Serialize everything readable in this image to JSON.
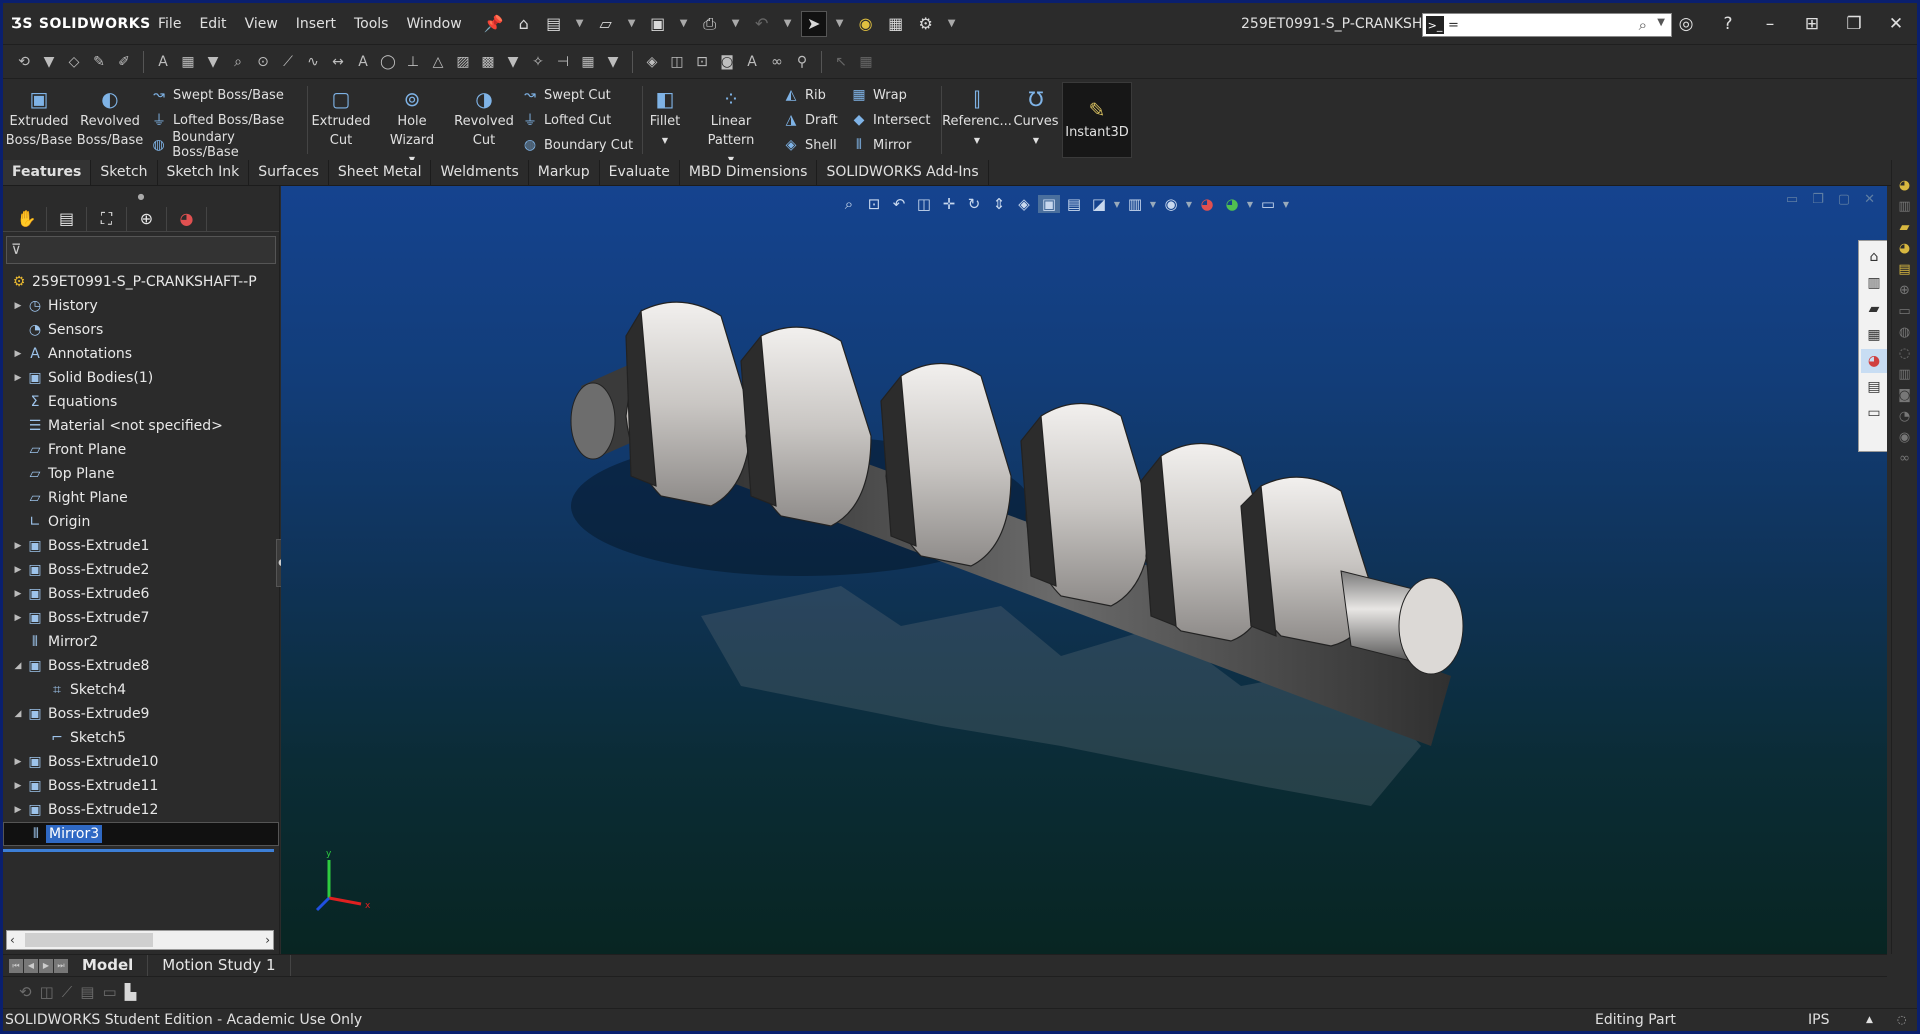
{
  "app": {
    "name": "SOLIDWORKS",
    "document_title": "259ET0991-S_P-CRANKSH...",
    "search_value": "="
  },
  "menu": [
    "File",
    "Edit",
    "View",
    "Insert",
    "Tools",
    "Window"
  ],
  "ribbon": {
    "extruded_boss": [
      "Extruded",
      "Boss/Base"
    ],
    "revolved_boss": [
      "Revolved",
      "Boss/Base"
    ],
    "boss_col": [
      "Swept Boss/Base",
      "Lofted Boss/Base",
      "Boundary Boss/Base"
    ],
    "extruded_cut": [
      "Extruded",
      "Cut"
    ],
    "hole_wizard": "Hole Wizard",
    "revolved_cut": [
      "Revolved",
      "Cut"
    ],
    "cut_col": [
      "Swept Cut",
      "Lofted Cut",
      "Boundary Cut"
    ],
    "fillet": "Fillet",
    "linear_pattern": "Linear Pattern",
    "rib_col": [
      "Rib",
      "Draft",
      "Shell"
    ],
    "wrap_col": [
      "Wrap",
      "Intersect",
      "Mirror"
    ],
    "reference": "Referenc...",
    "curves": "Curves",
    "instant3d": "Instant3D"
  },
  "tabs": [
    "Features",
    "Sketch",
    "Sketch Ink",
    "Surfaces",
    "Sheet Metal",
    "Weldments",
    "Markup",
    "Evaluate",
    "MBD Dimensions",
    "SOLIDWORKS Add-Ins"
  ],
  "active_tab": "Features",
  "tree": {
    "root": "259ET0991-S_P-CRANKSHAFT--P",
    "items": [
      "History",
      "Sensors",
      "Annotations",
      "Solid Bodies(1)",
      "Equations",
      "Material <not specified>",
      "Front Plane",
      "Top Plane",
      "Right Plane",
      "Origin",
      "Boss-Extrude1",
      "Boss-Extrude2",
      "Boss-Extrude6",
      "Boss-Extrude7",
      "Mirror2",
      "Boss-Extrude8",
      "Sketch4",
      "Boss-Extrude9",
      "Sketch5",
      "Boss-Extrude10",
      "Boss-Extrude11",
      "Boss-Extrude12",
      "Mirror3"
    ],
    "selected": "Mirror3"
  },
  "triad": {
    "x": "x",
    "y": "y"
  },
  "bottom_tabs": [
    "Model",
    "Motion Study 1"
  ],
  "status": {
    "left": "SOLIDWORKS Student Edition - Academic Use Only",
    "mode": "Editing Part",
    "units": "IPS"
  },
  "colors": {
    "chrome": "#2b2b2b",
    "selection": "#2f69c4",
    "viewport_top": "#15438f",
    "viewport_bottom": "#082522",
    "window_border": "#0a1f6e"
  }
}
